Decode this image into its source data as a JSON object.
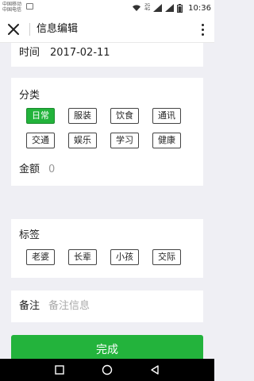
{
  "status_bar": {
    "carrier_1": "中国移动",
    "carrier_2": "中国电信",
    "net_1": "2G",
    "net_2": "4G",
    "time": "10:36"
  },
  "nav": {
    "title": "信息编辑"
  },
  "time_row": {
    "label": "时间",
    "value": "2017-02-11"
  },
  "category": {
    "label": "分类",
    "options": [
      "日常",
      "服装",
      "饮食",
      "通讯",
      "交通",
      "娱乐",
      "学习",
      "健康"
    ],
    "selected": "日常"
  },
  "amount": {
    "label": "金额",
    "value": "0"
  },
  "tags": {
    "label": "标签",
    "options": [
      "老婆",
      "长辈",
      "小孩",
      "交际"
    ]
  },
  "note": {
    "label": "备注",
    "placeholder": "备注信息"
  },
  "done_label": "完成",
  "colors": {
    "accent": "#23b33c",
    "background": "#efeff4"
  }
}
